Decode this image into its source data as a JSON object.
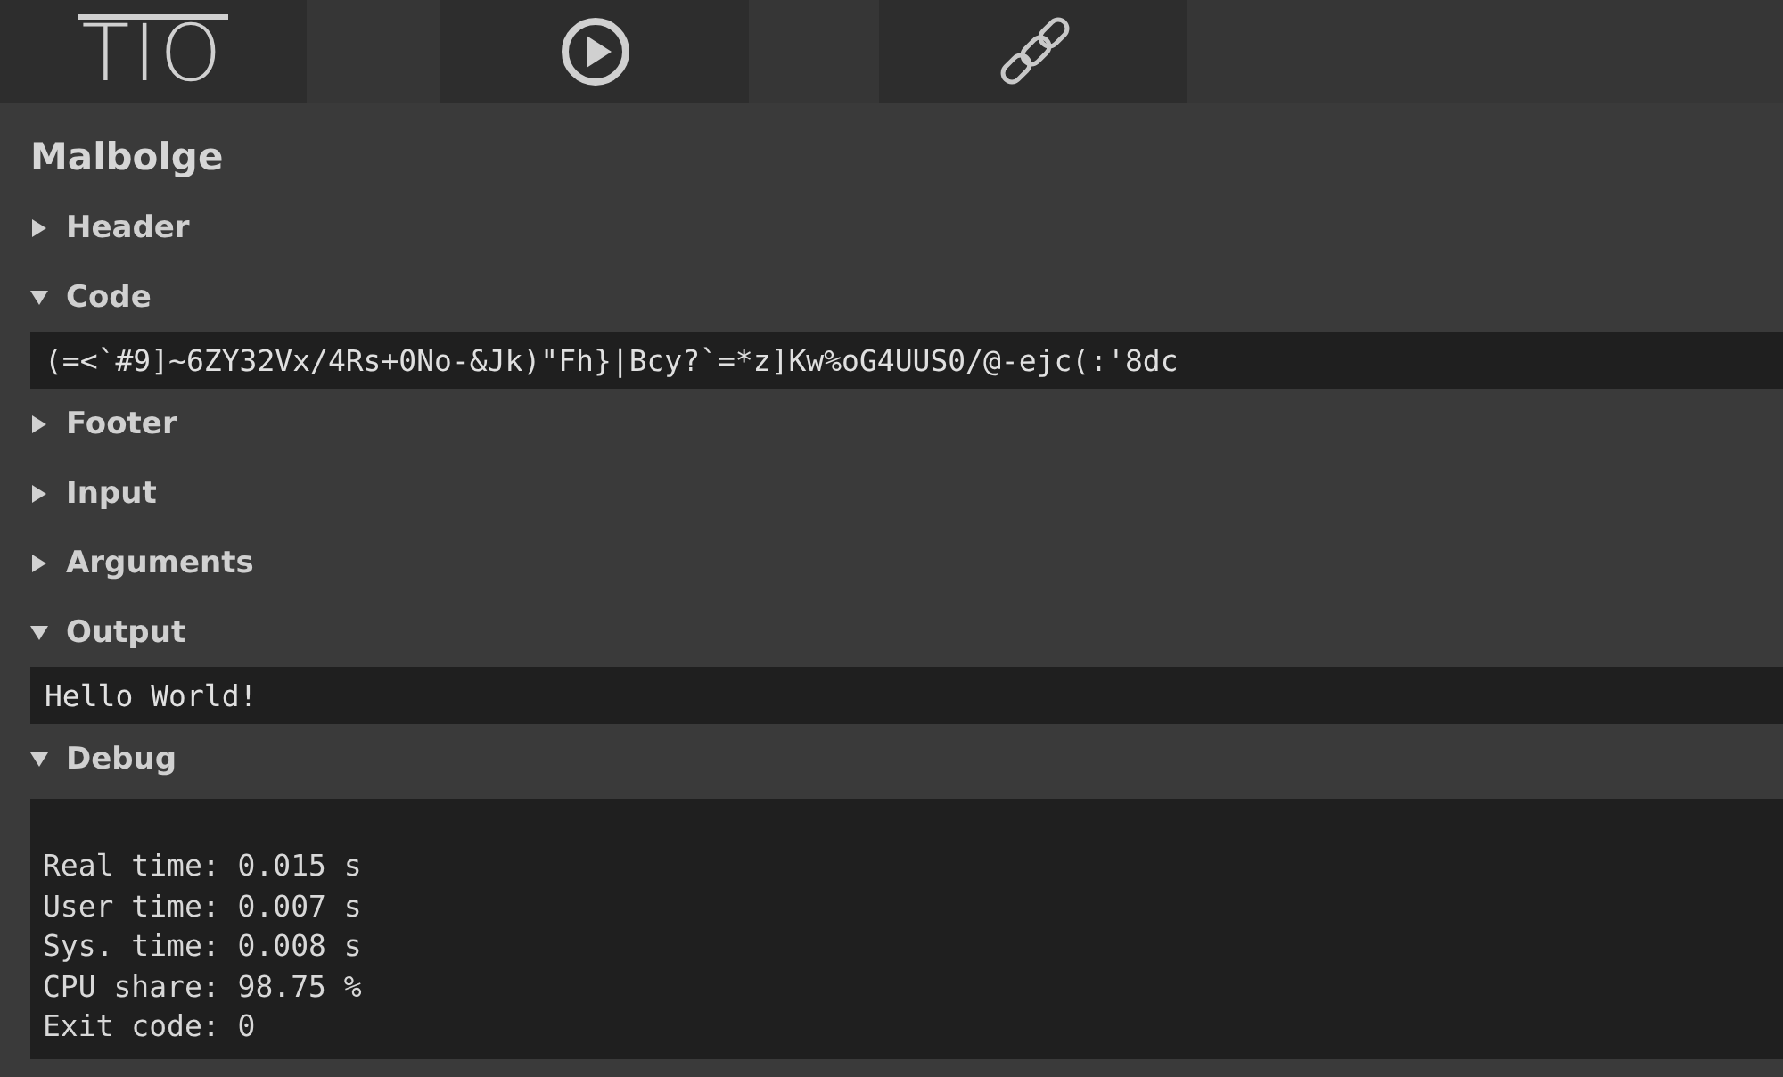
{
  "toolbar": {
    "logo": "TIO",
    "buttons": [
      {
        "kind": "run"
      },
      {
        "kind": "link"
      }
    ]
  },
  "language": "Malbolge",
  "sections": [
    {
      "label": "Header",
      "expanded": false
    },
    {
      "label": "Code",
      "expanded": true,
      "value": "(=<`#9]~6ZY32Vx/4Rs+0No-&Jk)\"Fh}|Bcy?`=*z]Kw%oG4UUS0/@-ejc(:'8dc"
    },
    {
      "label": "Footer",
      "expanded": false
    },
    {
      "label": "Input",
      "expanded": false
    },
    {
      "label": "Arguments",
      "expanded": false
    },
    {
      "label": "Output",
      "expanded": true,
      "value": "Hello World!"
    },
    {
      "label": "Debug",
      "expanded": true,
      "lines": [
        "Real time: 0.015 s",
        "User time: 0.007 s",
        "Sys. time: 0.008 s",
        "CPU share: 98.75 %",
        "Exit code: 0"
      ]
    }
  ]
}
